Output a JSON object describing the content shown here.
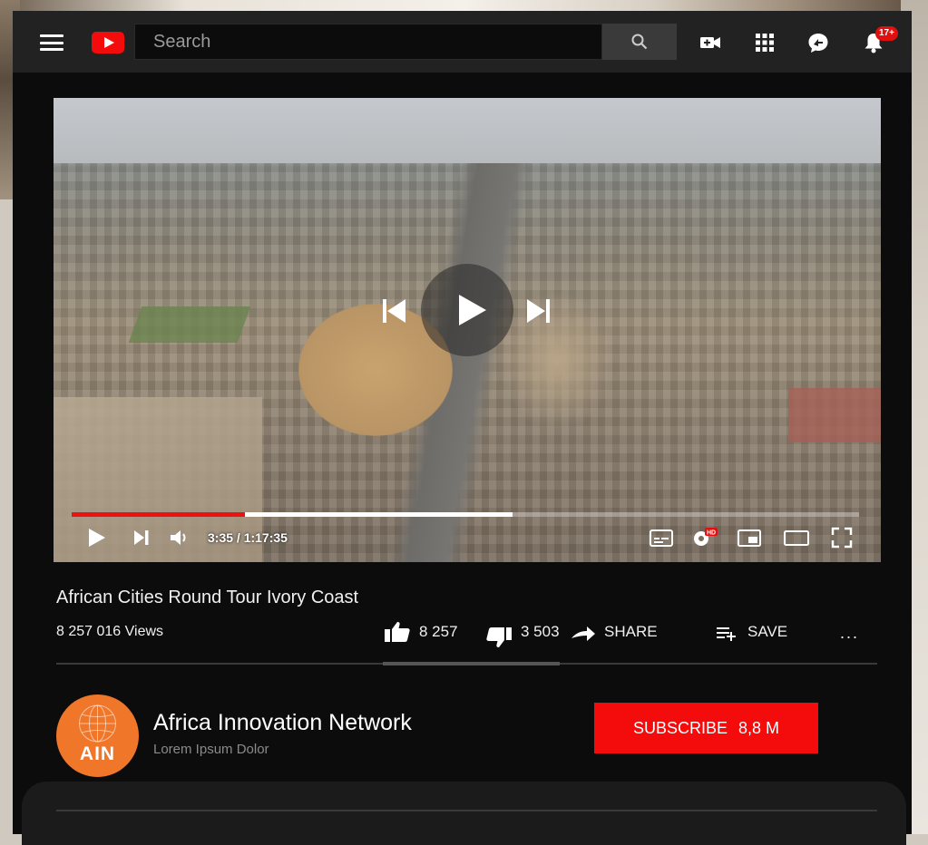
{
  "header": {
    "search_placeholder": "Search",
    "notification_count": "17+",
    "icons": [
      "menu-icon",
      "youtube-logo-icon",
      "search-icon",
      "create-video-icon",
      "apps-grid-icon",
      "messages-icon",
      "notifications-bell-icon"
    ]
  },
  "player": {
    "current_time": "3:35",
    "duration": "1:17:35",
    "time_display": "3:35 / 1:17:35",
    "progress_fraction": 0.22,
    "buffer_fraction": 0.56,
    "hd_badge": "HD",
    "colors": {
      "progress": "#ee1111",
      "buffer": "#ffffff"
    }
  },
  "video": {
    "title": "African Cities Round Tour Ivory Coast",
    "views": "8 257 016 Views",
    "likes": "8 257",
    "dislikes": "3 503",
    "share_label": "SHARE",
    "save_label": "SAVE",
    "more_label": "..."
  },
  "channel": {
    "name": "Africa Innovation Network",
    "description": "Lorem Ipsum Dolor",
    "avatar_text": "AIN",
    "avatar_color": "#f0762a",
    "subscribe_label": "SUBSCRIBE",
    "subscriber_count": "8,8 M"
  },
  "colors": {
    "brand_red": "#f40c0c",
    "background": "#0c0c0c",
    "topbar": "#222223"
  }
}
